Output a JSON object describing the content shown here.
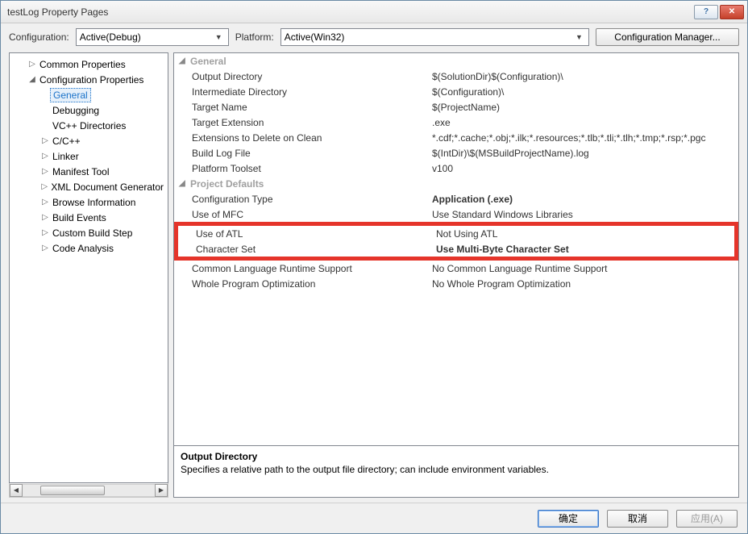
{
  "title": "testLog Property Pages",
  "topbar": {
    "configLabel": "Configuration:",
    "configValue": "Active(Debug)",
    "platformLabel": "Platform:",
    "platformValue": "Active(Win32)",
    "cfgMgr": "Configuration Manager..."
  },
  "tree": [
    {
      "lvl": 1,
      "exp": "▷",
      "label": "Common Properties"
    },
    {
      "lvl": 1,
      "exp": "◢",
      "label": "Configuration Properties"
    },
    {
      "lvl": 2,
      "exp": "",
      "label": "General",
      "sel": true
    },
    {
      "lvl": 2,
      "exp": "",
      "label": "Debugging"
    },
    {
      "lvl": 2,
      "exp": "",
      "label": "VC++ Directories"
    },
    {
      "lvl": 2,
      "exp": "▷",
      "label": "C/C++"
    },
    {
      "lvl": 2,
      "exp": "▷",
      "label": "Linker"
    },
    {
      "lvl": 2,
      "exp": "▷",
      "label": "Manifest Tool"
    },
    {
      "lvl": 2,
      "exp": "▷",
      "label": "XML Document Generator"
    },
    {
      "lvl": 2,
      "exp": "▷",
      "label": "Browse Information"
    },
    {
      "lvl": 2,
      "exp": "▷",
      "label": "Build Events"
    },
    {
      "lvl": 2,
      "exp": "▷",
      "label": "Custom Build Step"
    },
    {
      "lvl": 2,
      "exp": "▷",
      "label": "Code Analysis"
    }
  ],
  "cats": {
    "general": "General",
    "defaults": "Project Defaults"
  },
  "generalRows": [
    {
      "name": "Output Directory",
      "val": "$(SolutionDir)$(Configuration)\\"
    },
    {
      "name": "Intermediate Directory",
      "val": "$(Configuration)\\"
    },
    {
      "name": "Target Name",
      "val": "$(ProjectName)"
    },
    {
      "name": "Target Extension",
      "val": ".exe"
    },
    {
      "name": "Extensions to Delete on Clean",
      "val": "*.cdf;*.cache;*.obj;*.ilk;*.resources;*.tlb;*.tli;*.tlh;*.tmp;*.rsp;*.pgc"
    },
    {
      "name": "Build Log File",
      "val": "$(IntDir)\\$(MSBuildProjectName).log"
    },
    {
      "name": "Platform Toolset",
      "val": "v100"
    }
  ],
  "defaultRows": [
    {
      "name": "Configuration Type",
      "val": "Application (.exe)",
      "bold": true
    },
    {
      "name": "Use of MFC",
      "val": "Use Standard Windows Libraries"
    },
    {
      "name": "Use of ATL",
      "val": "Not Using ATL"
    },
    {
      "name": "Character Set",
      "val": "Use Multi-Byte Character Set",
      "bold": true
    },
    {
      "name": "Common Language Runtime Support",
      "val": "No Common Language Runtime Support"
    },
    {
      "name": "Whole Program Optimization",
      "val": "No Whole Program Optimization"
    }
  ],
  "desc": {
    "heading": "Output Directory",
    "body": "Specifies a relative path to the output file directory; can include environment variables."
  },
  "footer": {
    "ok": "确定",
    "cancel": "取消",
    "apply": "应用(A)"
  }
}
